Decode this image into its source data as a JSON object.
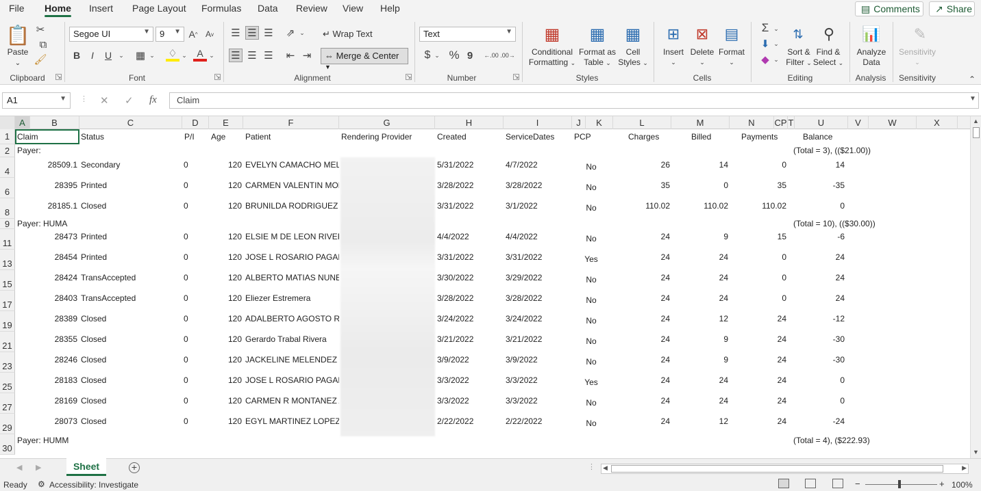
{
  "menu": {
    "tabs": [
      "File",
      "Home",
      "Insert",
      "Page Layout",
      "Formulas",
      "Data",
      "Review",
      "View",
      "Help"
    ],
    "active": "Home",
    "comments_label": "Comments",
    "share_label": "Share"
  },
  "ribbon": {
    "clipboard": {
      "paste": "Paste",
      "label": "Clipboard"
    },
    "font": {
      "name": "Segoe UI",
      "size": "9",
      "label": "Font",
      "bold": "B",
      "italic": "I",
      "underline": "U",
      "grow": "A",
      "shrink": "A"
    },
    "alignment": {
      "wrap": "Wrap Text",
      "merge": "Merge & Center",
      "label": "Alignment"
    },
    "number": {
      "format": "Text",
      "currency": "$",
      "percent": "%",
      "comma": "9",
      "inc": ".00",
      "dec": ".00",
      "label": "Number"
    },
    "styles": {
      "conditional_1": "Conditional",
      "conditional_2": "Formatting",
      "format_table_1": "Format as",
      "format_table_2": "Table",
      "cell_styles_1": "Cell",
      "cell_styles_2": "Styles",
      "label": "Styles"
    },
    "cells": {
      "insert": "Insert",
      "delete": "Delete",
      "format": "Format",
      "label": "Cells"
    },
    "editing": {
      "sort_1": "Sort &",
      "sort_2": "Filter",
      "find_1": "Find &",
      "find_2": "Select",
      "label": "Editing"
    },
    "analysis": {
      "analyze_1": "Analyze",
      "analyze_2": "Data",
      "label": "Analysis"
    },
    "sensitivity": {
      "btn": "Sensitivity",
      "label": "Sensitivity"
    }
  },
  "formula_bar": {
    "name_box": "A1",
    "fx": "fx",
    "content": "Claim"
  },
  "columns": [
    "A",
    "B",
    "C",
    "D",
    "E",
    "F",
    "G",
    "H",
    "I",
    "J",
    "K",
    "L",
    "M",
    "N",
    "CP",
    "T",
    "U",
    "V",
    "W",
    "X"
  ],
  "header_row": {
    "row": "1",
    "claim": "Claim",
    "status": "Status",
    "pi": "P/I",
    "age": "Age",
    "patient": "Patient",
    "provider": "Rendering Provider",
    "created": "Created",
    "service": "ServiceDates",
    "pcp": "PCP",
    "charges": "Charges",
    "billed": "Billed",
    "payments": "Payments",
    "balance": "Balance"
  },
  "payer_rows": [
    {
      "row": "2",
      "label": "Payer:",
      "total": "(Total = 3), (($21.00))"
    },
    {
      "row": "9",
      "label": "Payer: HUMA",
      "total": "(Total = 10), (($30.00))"
    },
    {
      "row": "30",
      "label": "Payer: HUMM",
      "total": "(Total = 4), ($222.93)"
    }
  ],
  "claims": [
    {
      "row": "4",
      "claim": "28509.1",
      "status": "Secondary",
      "pi": "0",
      "age": "120",
      "patient": "EVELYN CAMACHO MELE",
      "created": "5/31/2022",
      "service": "4/7/2022",
      "pcp": "No",
      "charges": "26",
      "billed": "14",
      "payments": "0",
      "balance": "14"
    },
    {
      "row": "6",
      "claim": "28395",
      "status": "Printed",
      "pi": "0",
      "age": "120",
      "patient": "CARMEN VALENTIN MOLI",
      "created": "3/28/2022",
      "service": "3/28/2022",
      "pcp": "No",
      "charges": "35",
      "billed": "0",
      "payments": "35",
      "balance": "-35"
    },
    {
      "row": "8",
      "claim": "28185.1",
      "status": "Closed",
      "pi": "0",
      "age": "120",
      "patient": "BRUNILDA RODRIGUEZ   R",
      "created": "3/31/2022",
      "service": "3/1/2022",
      "pcp": "No",
      "charges": "110.02",
      "billed": "110.02",
      "payments": "110.02",
      "balance": "0"
    },
    {
      "row": "11",
      "claim": "28473",
      "status": "Printed",
      "pi": "0",
      "age": "120",
      "patient": "ELSIE M DE LEON RIVERA",
      "created": "4/4/2022",
      "service": "4/4/2022",
      "pcp": "No",
      "charges": "24",
      "billed": "9",
      "payments": "15",
      "balance": "-6"
    },
    {
      "row": "13",
      "claim": "28454",
      "status": "Printed",
      "pi": "0",
      "age": "120",
      "patient": "JOSE L ROSARIO PAGAN",
      "created": "3/31/2022",
      "service": "3/31/2022",
      "pcp": "Yes",
      "charges": "24",
      "billed": "24",
      "payments": "0",
      "balance": "24"
    },
    {
      "row": "15",
      "claim": "28424",
      "status": "TransAccepted",
      "pi": "0",
      "age": "120",
      "patient": "ALBERTO MATIAS NUNEZ",
      "created": "3/30/2022",
      "service": "3/29/2022",
      "pcp": "No",
      "charges": "24",
      "billed": "24",
      "payments": "0",
      "balance": "24"
    },
    {
      "row": "17",
      "claim": "28403",
      "status": "TransAccepted",
      "pi": "0",
      "age": "120",
      "patient": "Eliezer Estremera",
      "created": "3/28/2022",
      "service": "3/28/2022",
      "pcp": "No",
      "charges": "24",
      "billed": "24",
      "payments": "0",
      "balance": "24"
    },
    {
      "row": "19",
      "claim": "28389",
      "status": "Closed",
      "pi": "0",
      "age": "120",
      "patient": "ADALBERTO AGOSTO RAM",
      "created": "3/24/2022",
      "service": "3/24/2022",
      "pcp": "No",
      "charges": "24",
      "billed": "12",
      "payments": "24",
      "balance": "-12"
    },
    {
      "row": "21",
      "claim": "28355",
      "status": "Closed",
      "pi": "0",
      "age": "120",
      "patient": "Gerardo Trabal Rivera",
      "created": "3/21/2022",
      "service": "3/21/2022",
      "pcp": "No",
      "charges": "24",
      "billed": "9",
      "payments": "24",
      "balance": "-30"
    },
    {
      "row": "23",
      "claim": "28246",
      "status": "Closed",
      "pi": "0",
      "age": "120",
      "patient": "JACKELINE MELENDEZ VA",
      "created": "3/9/2022",
      "service": "3/9/2022",
      "pcp": "No",
      "charges": "24",
      "billed": "9",
      "payments": "24",
      "balance": "-30"
    },
    {
      "row": "25",
      "claim": "28183",
      "status": "Closed",
      "pi": "0",
      "age": "120",
      "patient": "JOSE L ROSARIO PAGAN",
      "created": "3/3/2022",
      "service": "3/3/2022",
      "pcp": "Yes",
      "charges": "24",
      "billed": "24",
      "payments": "24",
      "balance": "0"
    },
    {
      "row": "27",
      "claim": "28169",
      "status": "Closed",
      "pi": "0",
      "age": "120",
      "patient": "CARMEN R MONTANEZ A",
      "created": "3/3/2022",
      "service": "3/3/2022",
      "pcp": "No",
      "charges": "24",
      "billed": "24",
      "payments": "24",
      "balance": "0"
    },
    {
      "row": "29",
      "claim": "28073",
      "status": "Closed",
      "pi": "0",
      "age": "120",
      "patient": "EGYL MARTINEZ LOPEZ",
      "created": "2/22/2022",
      "service": "2/22/2022",
      "pcp": "No",
      "charges": "24",
      "billed": "12",
      "payments": "24",
      "balance": "-24"
    }
  ],
  "sheet_tab": "Sheet",
  "status": {
    "ready": "Ready",
    "accessibility": "Accessibility: Investigate",
    "zoom": "100%"
  }
}
